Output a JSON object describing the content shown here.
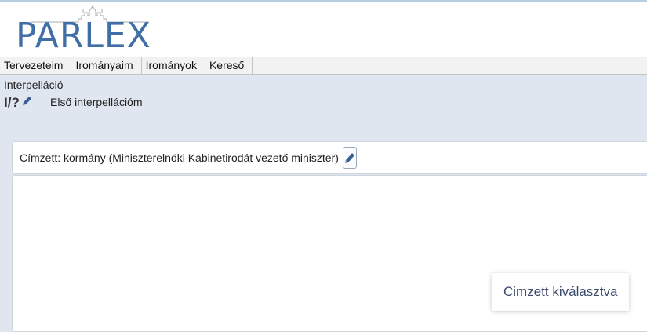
{
  "logo": {
    "text": "PARLEX"
  },
  "menu": {
    "items": [
      {
        "label": "Tervezeteim"
      },
      {
        "label": "Irományaim"
      },
      {
        "label": "Irományok"
      },
      {
        "label": "Kereső"
      }
    ]
  },
  "document": {
    "type": "Interpelláció",
    "id": "I/?",
    "title": "Első interpellációm"
  },
  "addressee": {
    "text": "Címzett: kormány (Miniszterelnöki Kabinetirodát vezető miniszter)"
  },
  "toast": {
    "message": "Cimzett kiválasztva"
  },
  "colors": {
    "brand": "#3f6fa6",
    "page_bg": "#dfe6ef",
    "icon": "#3a5f95"
  }
}
